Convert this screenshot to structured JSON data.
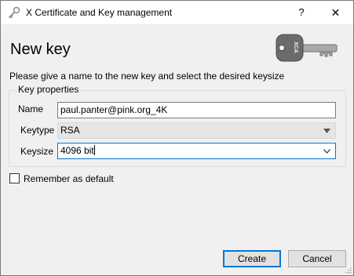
{
  "window": {
    "title": "X Certificate and Key management",
    "help_glyph": "?",
    "close_glyph": "✕"
  },
  "page": {
    "title": "New key",
    "description": "Please give a name to the new key and select the desired keysize"
  },
  "key_properties": {
    "group_title": "Key properties",
    "name_label": "Name",
    "name_value": "paul.panter@pink.org_4K",
    "keytype_label": "Keytype",
    "keytype_value": "RSA",
    "keysize_label": "Keysize",
    "keysize_value": "4096 bit"
  },
  "options": {
    "remember_label": "Remember as default",
    "remember_checked": false
  },
  "buttons": {
    "create": "Create",
    "cancel": "Cancel"
  },
  "colors": {
    "focus_accent": "#0078d7",
    "dialog_bg": "#f0f0f0"
  },
  "icons": {
    "app": "certificate-key-icon",
    "key_image": "key-illustration"
  }
}
